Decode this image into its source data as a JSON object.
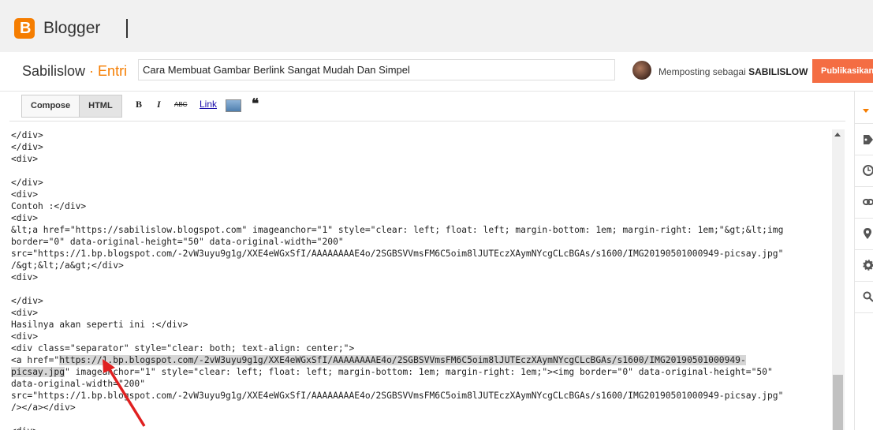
{
  "app": {
    "brand": "Blogger"
  },
  "post": {
    "blog_name": "Sabilislow",
    "separator": " · ",
    "entry_label": "Entri",
    "title_value": "Cara Membuat Gambar Berlink Sangat Mudah Dan Simpel",
    "posting_as_prefix": "Memposting sebagai ",
    "posting_as_user": "SABILISLOW",
    "publish_label": "Publikasikan"
  },
  "toolbar": {
    "compose_label": "Compose",
    "html_label": "HTML",
    "bold_label": "B",
    "italic_label": "I",
    "strike_label": "ABC",
    "link_label": "Link",
    "quote_label": "❝"
  },
  "colors": {
    "accent": "#f57d00",
    "publish": "#f46d43",
    "highlight": "#d6d6d6"
  },
  "editor": {
    "lines": [
      "</div>",
      "</div>",
      "<div>",
      "",
      "</div>",
      "<div>",
      "Contoh :</div>",
      "<div>",
      "&lt;a href=\"https://sabilislow.blogspot.com\" imageanchor=\"1\" style=\"clear: left; float: left; margin-bottom: 1em; margin-right: 1em;\"&gt;&lt;img",
      "border=\"0\" data-original-height=\"50\" data-original-width=\"200\"",
      "src=\"https://1.bp.blogspot.com/-2vW3uyu9g1g/XXE4eWGxSfI/AAAAAAAAE4o/2SGBSVVmsFM6C5oim8lJUTEczXAymNYcgCLcBGAs/s1600/IMG20190501000949-picsay.jpg\"",
      "/&gt;&lt;/a&gt;</div>",
      "<div>",
      "",
      "</div>",
      "<div>",
      "Hasilnya akan seperti ini :</div>",
      "<div>",
      "<div class=\"separator\" style=\"clear: both; text-align: center;\">"
    ],
    "hl_line1_prefix": "<a href=\"",
    "hl_line1_url": "https://1.bp.blogspot.com/-2vW3uyu9g1g/XXE4eWGxSfI/AAAAAAAAE4o/2SGBSVVmsFM6C5oim8lJUTEczXAymNYcgCLcBGAs/s1600/IMG20190501000949-",
    "hl_line2_url": "picsay.jpg",
    "hl_line2_rest": "\" imageanchor=\"1\" style=\"clear: left; float: left; margin-bottom: 1em; margin-right: 1em;\"><img border=\"0\" data-original-height=\"50\"",
    "after_lines": [
      "data-original-width=\"200\"",
      "src=\"https://1.bp.blogspot.com/-2vW3uyu9g1g/XXE4eWGxSfI/AAAAAAAAE4o/2SGBSVVmsFM6C5oim8lJUTEczXAymNYcgCLcBGAs/s1600/IMG20190501000949-picsay.jpg\"",
      "/></a></div>",
      "",
      "<div>"
    ]
  },
  "rail": {
    "icons": [
      "caret-icon",
      "label-icon",
      "clock-icon",
      "link-icon",
      "location-icon",
      "gear-icon",
      "search-icon"
    ]
  }
}
